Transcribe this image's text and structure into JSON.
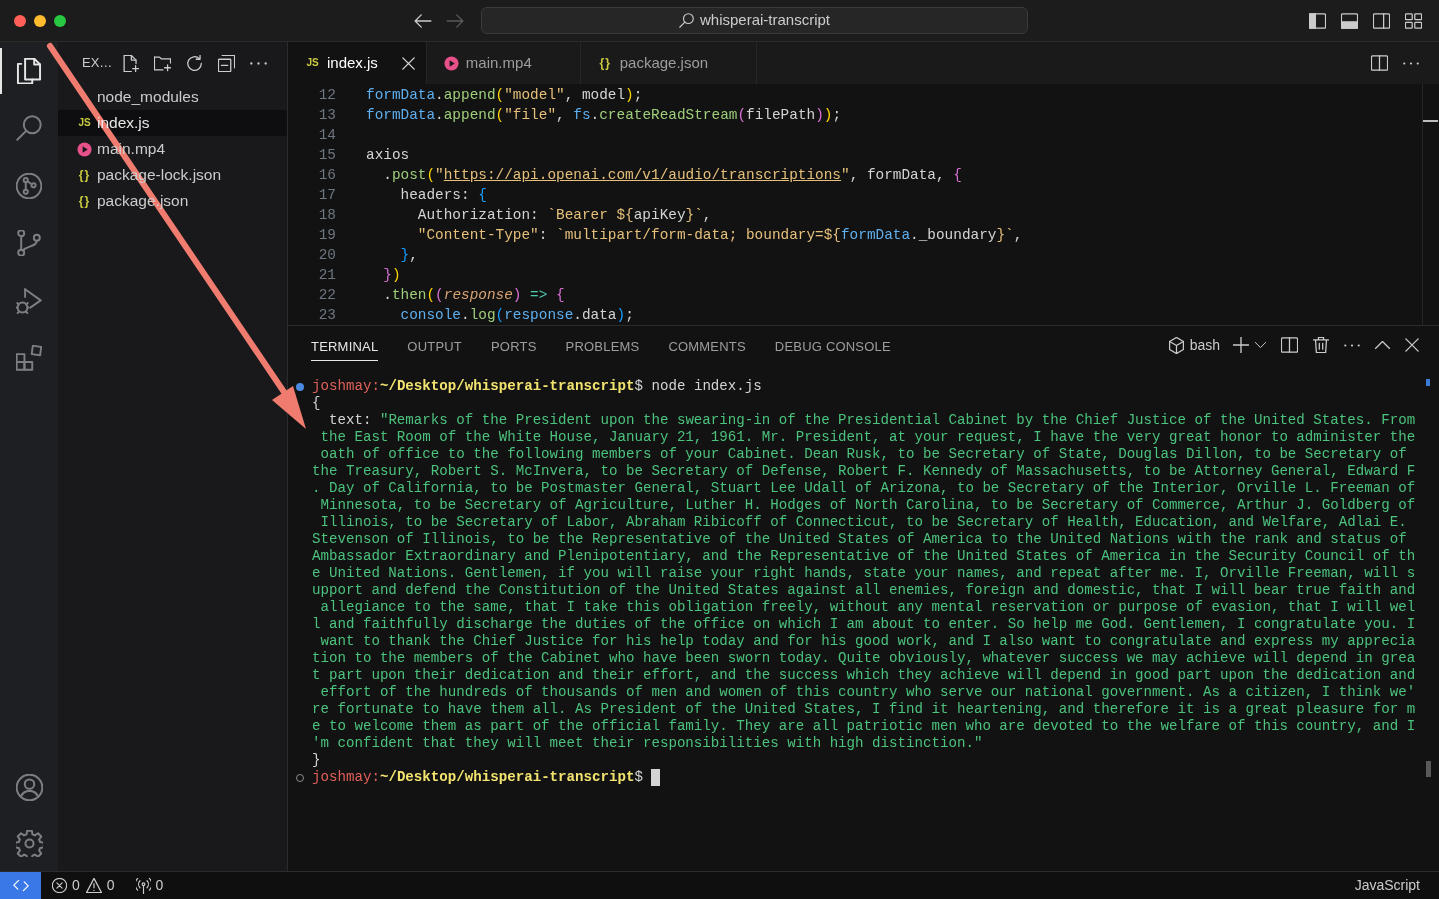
{
  "window": {
    "title": "whisperai-transcript",
    "controls": [
      {
        "kind": "close"
      },
      {
        "kind": "minimize"
      },
      {
        "kind": "zoom"
      }
    ],
    "navigation": [
      {
        "kind": "back",
        "disabled": false
      },
      {
        "kind": "forward",
        "disabled": true
      }
    ],
    "layout_controls": [
      {
        "kind": "primary_sidebar",
        "on": true
      },
      {
        "kind": "panel",
        "on": true
      },
      {
        "kind": "secondary_sidebar",
        "on": false
      },
      {
        "kind": "customize_layout"
      }
    ]
  },
  "activity_bar": {
    "items": [
      {
        "kind": "explorer",
        "selected": true
      },
      {
        "kind": "search",
        "selected": false
      },
      {
        "kind": "git_graph",
        "selected": false
      },
      {
        "kind": "source_control",
        "selected": false
      },
      {
        "kind": "run_and_debug",
        "selected": false
      },
      {
        "kind": "extensions",
        "selected": false
      }
    ],
    "bottom_items": [
      {
        "kind": "accounts"
      },
      {
        "kind": "manage"
      }
    ]
  },
  "sidebar": {
    "title": "EX…",
    "actions": [
      {
        "kind": "new_file"
      },
      {
        "kind": "new_folder"
      },
      {
        "kind": "refresh"
      },
      {
        "kind": "collapse_all"
      },
      {
        "kind": "more"
      }
    ],
    "files": [
      {
        "name": "node_modules",
        "kind": "folder",
        "selected": false
      },
      {
        "name": "index.js",
        "kind": "js",
        "icon_text": "JS",
        "selected": true
      },
      {
        "name": "main.mp4",
        "kind": "video",
        "selected": false
      },
      {
        "name": "package-lock.json",
        "kind": "json",
        "icon_text": "{}",
        "selected": false
      },
      {
        "name": "package.json",
        "kind": "json",
        "icon_text": "{}",
        "selected": false
      }
    ]
  },
  "editor": {
    "tabs": [
      {
        "label": "index.js",
        "kind": "js",
        "icon_text": "JS",
        "selected": true
      },
      {
        "label": "main.mp4",
        "kind": "video",
        "selected": false
      },
      {
        "label": "package.json",
        "kind": "json",
        "icon_text": "{}",
        "selected": false
      }
    ],
    "actions": [
      {
        "kind": "split"
      },
      {
        "kind": "more"
      }
    ],
    "lines": [
      {
        "number": "12",
        "tokens": [
          {
            "text": "formData",
            "kind": "variable"
          },
          {
            "text": ".",
            "kind": "plain"
          },
          {
            "text": "append",
            "kind": "function"
          },
          {
            "text": "(",
            "kind": "bracket1"
          },
          {
            "text": "\"model\"",
            "kind": "string"
          },
          {
            "text": ", model",
            "kind": "plain"
          },
          {
            "text": ")",
            "kind": "bracket1"
          },
          {
            "text": ";",
            "kind": "plain"
          }
        ]
      },
      {
        "number": "13",
        "tokens": [
          {
            "text": "formData",
            "kind": "variable"
          },
          {
            "text": ".",
            "kind": "plain"
          },
          {
            "text": "append",
            "kind": "function"
          },
          {
            "text": "(",
            "kind": "bracket1"
          },
          {
            "text": "\"file\"",
            "kind": "string"
          },
          {
            "text": ", ",
            "kind": "plain"
          },
          {
            "text": "fs",
            "kind": "variable"
          },
          {
            "text": ".",
            "kind": "plain"
          },
          {
            "text": "createReadStream",
            "kind": "function"
          },
          {
            "text": "(",
            "kind": "bracket2"
          },
          {
            "text": "filePath",
            "kind": "plain"
          },
          {
            "text": ")",
            "kind": "bracket2"
          },
          {
            "text": ")",
            "kind": "bracket1"
          },
          {
            "text": ";",
            "kind": "plain"
          }
        ]
      },
      {
        "number": "14"
      },
      {
        "number": "15",
        "tokens": [
          {
            "text": "axios",
            "kind": "plain"
          }
        ]
      },
      {
        "number": "16",
        "tokens": [
          {
            "text": "  .",
            "kind": "plain"
          },
          {
            "text": "post",
            "kind": "function"
          },
          {
            "text": "(",
            "kind": "bracket1"
          },
          {
            "text": "\"",
            "kind": "string"
          },
          {
            "text": "https://api.openai.com/v1/audio/transcriptions",
            "kind": "link"
          },
          {
            "text": "\"",
            "kind": "string"
          },
          {
            "text": ", formData, ",
            "kind": "plain"
          },
          {
            "text": "{",
            "kind": "bracket2"
          }
        ]
      },
      {
        "number": "17",
        "tokens": [
          {
            "text": "    headers: ",
            "kind": "plain"
          },
          {
            "text": "{",
            "kind": "bracket3"
          }
        ]
      },
      {
        "number": "18",
        "tokens": [
          {
            "text": "      Authorization: ",
            "kind": "plain"
          },
          {
            "text": "`Bearer ${",
            "kind": "string"
          },
          {
            "text": "apiKey",
            "kind": "plain"
          },
          {
            "text": "}`",
            "kind": "string"
          },
          {
            "text": ",",
            "kind": "plain"
          }
        ]
      },
      {
        "number": "19",
        "tokens": [
          {
            "text": "      \"Content-Type\"",
            "kind": "string"
          },
          {
            "text": ": ",
            "kind": "plain"
          },
          {
            "text": "`multipart/form-data; boundary=${",
            "kind": "string"
          },
          {
            "text": "formData",
            "kind": "variable"
          },
          {
            "text": "._boundary",
            "kind": "plain"
          },
          {
            "text": "}`",
            "kind": "string"
          },
          {
            "text": ",",
            "kind": "plain"
          }
        ]
      },
      {
        "number": "20",
        "tokens": [
          {
            "text": "    }",
            "kind": "bracket3"
          },
          {
            "text": ",",
            "kind": "plain"
          }
        ]
      },
      {
        "number": "21",
        "tokens": [
          {
            "text": "  }",
            "kind": "bracket2"
          },
          {
            "text": ")",
            "kind": "bracket1"
          }
        ]
      },
      {
        "number": "22",
        "tokens": [
          {
            "text": "  .",
            "kind": "plain"
          },
          {
            "text": "then",
            "kind": "function"
          },
          {
            "text": "(",
            "kind": "bracket1"
          },
          {
            "text": "(",
            "kind": "bracket2"
          },
          {
            "text": "response",
            "kind": "parameter"
          },
          {
            "text": ")",
            "kind": "bracket2"
          },
          {
            "text": " => ",
            "kind": "operator"
          },
          {
            "text": "{",
            "kind": "bracket2"
          }
        ]
      },
      {
        "number": "23",
        "tokens": [
          {
            "text": "    console",
            "kind": "variable"
          },
          {
            "text": ".",
            "kind": "plain"
          },
          {
            "text": "log",
            "kind": "function"
          },
          {
            "text": "(",
            "kind": "bracket3"
          },
          {
            "text": "response",
            "kind": "variable"
          },
          {
            "text": ".data",
            "kind": "plain"
          },
          {
            "text": ")",
            "kind": "bracket3"
          },
          {
            "text": ";",
            "kind": "plain"
          }
        ]
      }
    ]
  },
  "panel": {
    "tabs": [
      {
        "label": "TERMINAL",
        "selected": true
      },
      {
        "label": "OUTPUT",
        "selected": false
      },
      {
        "label": "PORTS",
        "selected": false
      },
      {
        "label": "PROBLEMS",
        "selected": false
      },
      {
        "label": "COMMENTS",
        "selected": false
      },
      {
        "label": "DEBUG CONSOLE",
        "selected": false
      }
    ],
    "terminal_profile": "bash",
    "actions": [
      {
        "kind": "new_terminal"
      },
      {
        "kind": "launch_profile"
      },
      {
        "kind": "split"
      },
      {
        "kind": "kill"
      },
      {
        "kind": "more"
      },
      {
        "kind": "maximize"
      },
      {
        "kind": "close"
      }
    ],
    "terminal": {
      "lines": [
        {
          "kind": "command",
          "completed": true,
          "user": "joshmay",
          "separator": ":",
          "path": "~/Desktop/whisperai-transcript",
          "symbol": "$",
          "command": "node index.js"
        },
        {
          "kind": "plain",
          "text": "{"
        },
        {
          "kind": "property",
          "key": "text:",
          "value": "\"Remarks of the President upon the swearing-in of the Presidential Cabinet by the Chief Justice of the United States. From the East Room of the White House, January 21, 1961. Mr. President, at your request, I have the very great honor to administer the oath of office to the following members of your Cabinet. Dean Rusk, to be Secretary of State, Douglas Dillon, to be Secretary of the Treasury, Robert S. McInvera, to be Secretary of Defense, Robert F. Kennedy of Massachusetts, to be Attorney General, Edward F. Day of California, to be Postmaster General, Stuart Lee Udall of Arizona, to be Secretary of the Interior, Orville L. Freeman of Minnesota, to be Secretary of Agriculture, Luther H. Hodges of North Carolina, to be Secretary of Commerce, Arthur J. Goldberg of Illinois, to be Secretary of Labor, Abraham Ribicoff of Connecticut, to be Secretary of Health, Education, and Welfare, Adlai E. Stevenson of Illinois, to be the Representative of the United States of America to the United Nations with the rank and status of Ambassador Extraordinary and Plenipotentiary, and the Representative of the United States of America in the Security Council of the United Nations. Gentlemen, if you will raise your right hands, state your names, and repeat after me. I, Orville Freeman, will support and defend the Constitution of the United States against all enemies, foreign and domestic, that I will bear true faith and allegiance to the same, that I take this obligation freely, without any mental reservation or purpose of evasion, that I will well and faithfully discharge the duties of the office on which I am about to enter. So help me God. Gentlemen, I congratulate you. I want to thank the Chief Justice for his help today and for his good work, and I also want to congratulate and express my appreciation to the members of the Cabinet who have been sworn today. Quite obviously, whatever success we may achieve will depend in great part upon their dedication and their effort, and the success which they achieve will depend in good part upon the dedication and effort of the hundreds of thousands of men and women of this country who serve our national government. As a citizen, I think we're fortunate to have them all. As President of the United States, I find it heartening, and therefore it is a great pleasure for me to welcome them as part of the official family. They are all patriotic men who are devoted to the welfare of this country, and I'm confident that they will meet their responsibilities with high distinction.\""
        },
        {
          "kind": "plain",
          "text": "}"
        },
        {
          "kind": "command",
          "completed": false,
          "user": "joshmay",
          "separator": ":",
          "path": "~/Desktop/whisperai-transcript",
          "symbol": "$",
          "cursor": true
        }
      ]
    }
  },
  "status_bar": {
    "items": [
      {
        "kind": "errors",
        "count": "0"
      },
      {
        "kind": "warnings",
        "count": "0"
      },
      {
        "kind": "ports",
        "count": "0"
      }
    ],
    "language": "JavaScript"
  }
}
